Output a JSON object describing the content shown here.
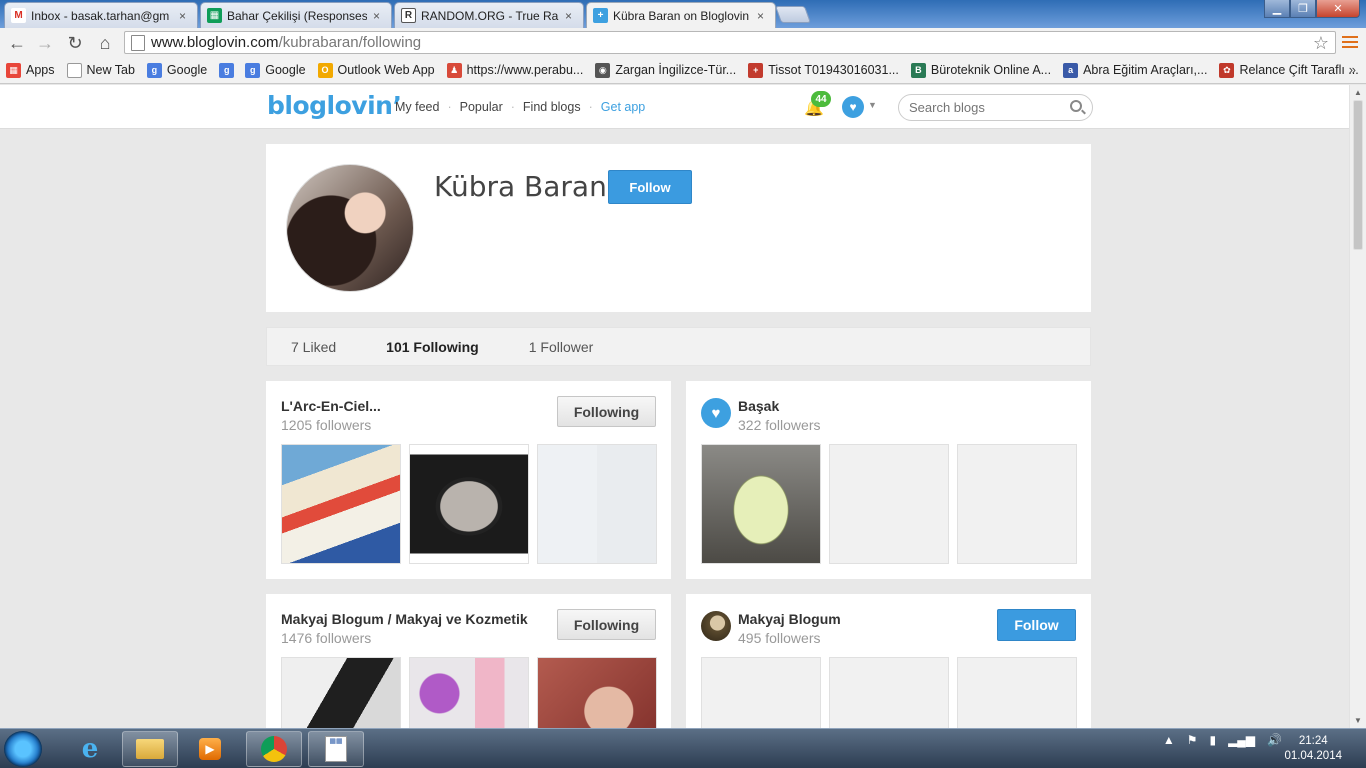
{
  "browser": {
    "tabs": [
      {
        "title": "Inbox - basak.tarhan@gm",
        "favicon": "gmail-icon",
        "color": "#d93025",
        "glyph": "M"
      },
      {
        "title": "Bahar Çekilişi (Responses)",
        "favicon": "sheets-icon",
        "color": "#0f9d58",
        "glyph": "▦"
      },
      {
        "title": "RANDOM.ORG - True Ran",
        "favicon": "random-org-icon",
        "color": "#555555",
        "glyph": "R"
      },
      {
        "title": "Kübra Baran on Bloglovin",
        "favicon": "bloglovin-icon",
        "color": "#3da0e0",
        "glyph": "+"
      }
    ],
    "close_glyph": "×",
    "url_host": "www.bloglovin.com",
    "url_path": "/kubrabaran/following",
    "bookmarks": [
      {
        "label": "Apps",
        "icon": "apps-grid-icon",
        "color": "#e8463a"
      },
      {
        "label": "New Tab",
        "icon": "page-icon",
        "color": "#9e9e9e"
      },
      {
        "label": "Google",
        "icon": "google-icon",
        "color": "#4a7de0"
      },
      {
        "label": "",
        "icon": "google-icon",
        "color": "#4a7de0"
      },
      {
        "label": "Google",
        "icon": "google-icon",
        "color": "#4a7de0"
      },
      {
        "label": "Outlook Web App",
        "icon": "outlook-icon",
        "color": "#f2a900"
      },
      {
        "label": "https://www.perabu...",
        "icon": "perabu-icon",
        "color": "#d84a3a"
      },
      {
        "label": "Zargan İngilizce-Tür...",
        "icon": "zargan-icon",
        "color": "#555555"
      },
      {
        "label": "Tissot T01943016031...",
        "icon": "tissot-icon",
        "color": "#c23b2e"
      },
      {
        "label": "Büroteknik Online A...",
        "icon": "buroteknik-icon",
        "color": "#2a7a55"
      },
      {
        "label": "Abra Eğitim Araçları,...",
        "icon": "abra-icon",
        "color": "#3a5aa8"
      },
      {
        "label": "Relance Çift Taraflı ...",
        "icon": "relance-icon",
        "color": "#c0392b"
      }
    ],
    "bookmarks_more": "»"
  },
  "site": {
    "logo": "bloglovin’",
    "nav": [
      "My feed",
      "Popular",
      "Find blogs",
      "Get app"
    ],
    "nav_sep": "·",
    "notif_count": "44",
    "search_placeholder": "Search blogs"
  },
  "profile": {
    "name": "Kübra Baran",
    "follow_label": "Follow"
  },
  "stats": [
    {
      "label": "7 Liked",
      "current": false
    },
    {
      "label": "101 Following",
      "current": true
    },
    {
      "label": "1 Follower",
      "current": false
    }
  ],
  "blogs": [
    {
      "name": "L'Arc-En-Ciel...",
      "followers": "1205 followers",
      "button": "Following",
      "state": "following",
      "icon": "",
      "thumbs": [
        "t-cream",
        "t-shadow",
        "t-isis"
      ]
    },
    {
      "name": "Başak",
      "followers": "322 followers",
      "button": "",
      "state": "none",
      "icon": "heart-avatar-icon",
      "thumbs": [
        "t-coconut",
        "",
        ""
      ]
    },
    {
      "name": "Makyaj Blogum / Makyaj ve Kozmetik",
      "followers": "1476 followers",
      "button": "Following",
      "state": "following",
      "icon": "",
      "thumbs": [
        "t-mascara",
        "t-flower",
        "t-face"
      ]
    },
    {
      "name": "Makyaj Blogum",
      "followers": "495 followers",
      "button": "Follow",
      "state": "follow",
      "icon": "blog-avatar-icon",
      "thumbs": [
        "",
        "",
        ""
      ]
    }
  ],
  "taskbar": {
    "time": "21:24",
    "date": "01.04.2014"
  },
  "colors": {
    "accent": "#3da0e0",
    "follow_button": "#3b9be0",
    "badge": "#4cbb3c"
  }
}
